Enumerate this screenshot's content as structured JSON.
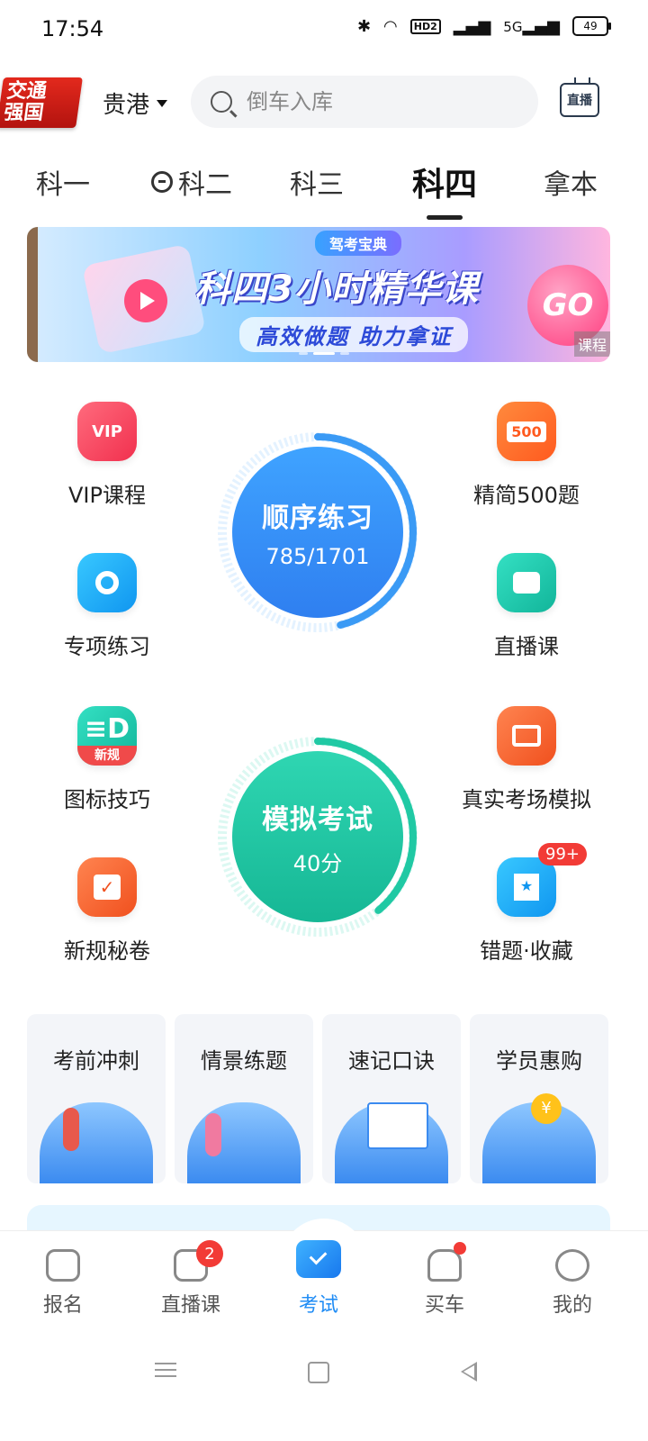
{
  "status_bar": {
    "time": "17:54",
    "battery": "49",
    "network": "5G",
    "hd": "HD2"
  },
  "header": {
    "logo_line1": "交通",
    "logo_line2": "强国",
    "city": "贵港",
    "search_placeholder": "倒车入库",
    "live_label": "直播"
  },
  "subject_tabs": [
    {
      "label": "科一"
    },
    {
      "label": "科二"
    },
    {
      "label": "科三"
    },
    {
      "label": "科四",
      "active": true
    },
    {
      "label": "拿本"
    }
  ],
  "banner": {
    "brand": "驾考宝典",
    "headline": "科四3小时精华课",
    "subline": "高效做题 助力拿证",
    "go": "GO",
    "tag": "课程"
  },
  "features": {
    "vip": {
      "label": "VIP课程",
      "icon_text": "VIP"
    },
    "simplified500": {
      "label": "精简500题",
      "icon_text": "500"
    },
    "special": {
      "label": "专项练习"
    },
    "live": {
      "label": "直播课"
    },
    "sign_tips": {
      "label": "图标技巧",
      "icon_text": "新规"
    },
    "real_exam": {
      "label": "真实考场模拟"
    },
    "new_rules": {
      "label": "新规秘卷"
    },
    "mistakes": {
      "label": "错题·收藏",
      "badge": "99+"
    }
  },
  "sequential": {
    "title": "顺序练习",
    "progress": "785/1701",
    "done": 785,
    "total": 1701
  },
  "mock_exam": {
    "title": "模拟考试",
    "score": "40分"
  },
  "cards": [
    {
      "title": "考前冲刺"
    },
    {
      "title": "情景练题"
    },
    {
      "title": "速记口诀"
    },
    {
      "title": "学员惠购"
    }
  ],
  "bottom_nav": [
    {
      "label": "报名"
    },
    {
      "label": "直播课",
      "badge": "2"
    },
    {
      "label": "考试",
      "active": true
    },
    {
      "label": "买车"
    },
    {
      "label": "我的"
    }
  ],
  "colors": {
    "accent": "#1f8cf5",
    "badge": "#f23b36",
    "blue_circle": "#3a8cf5",
    "green_circle": "#22c8a6"
  }
}
